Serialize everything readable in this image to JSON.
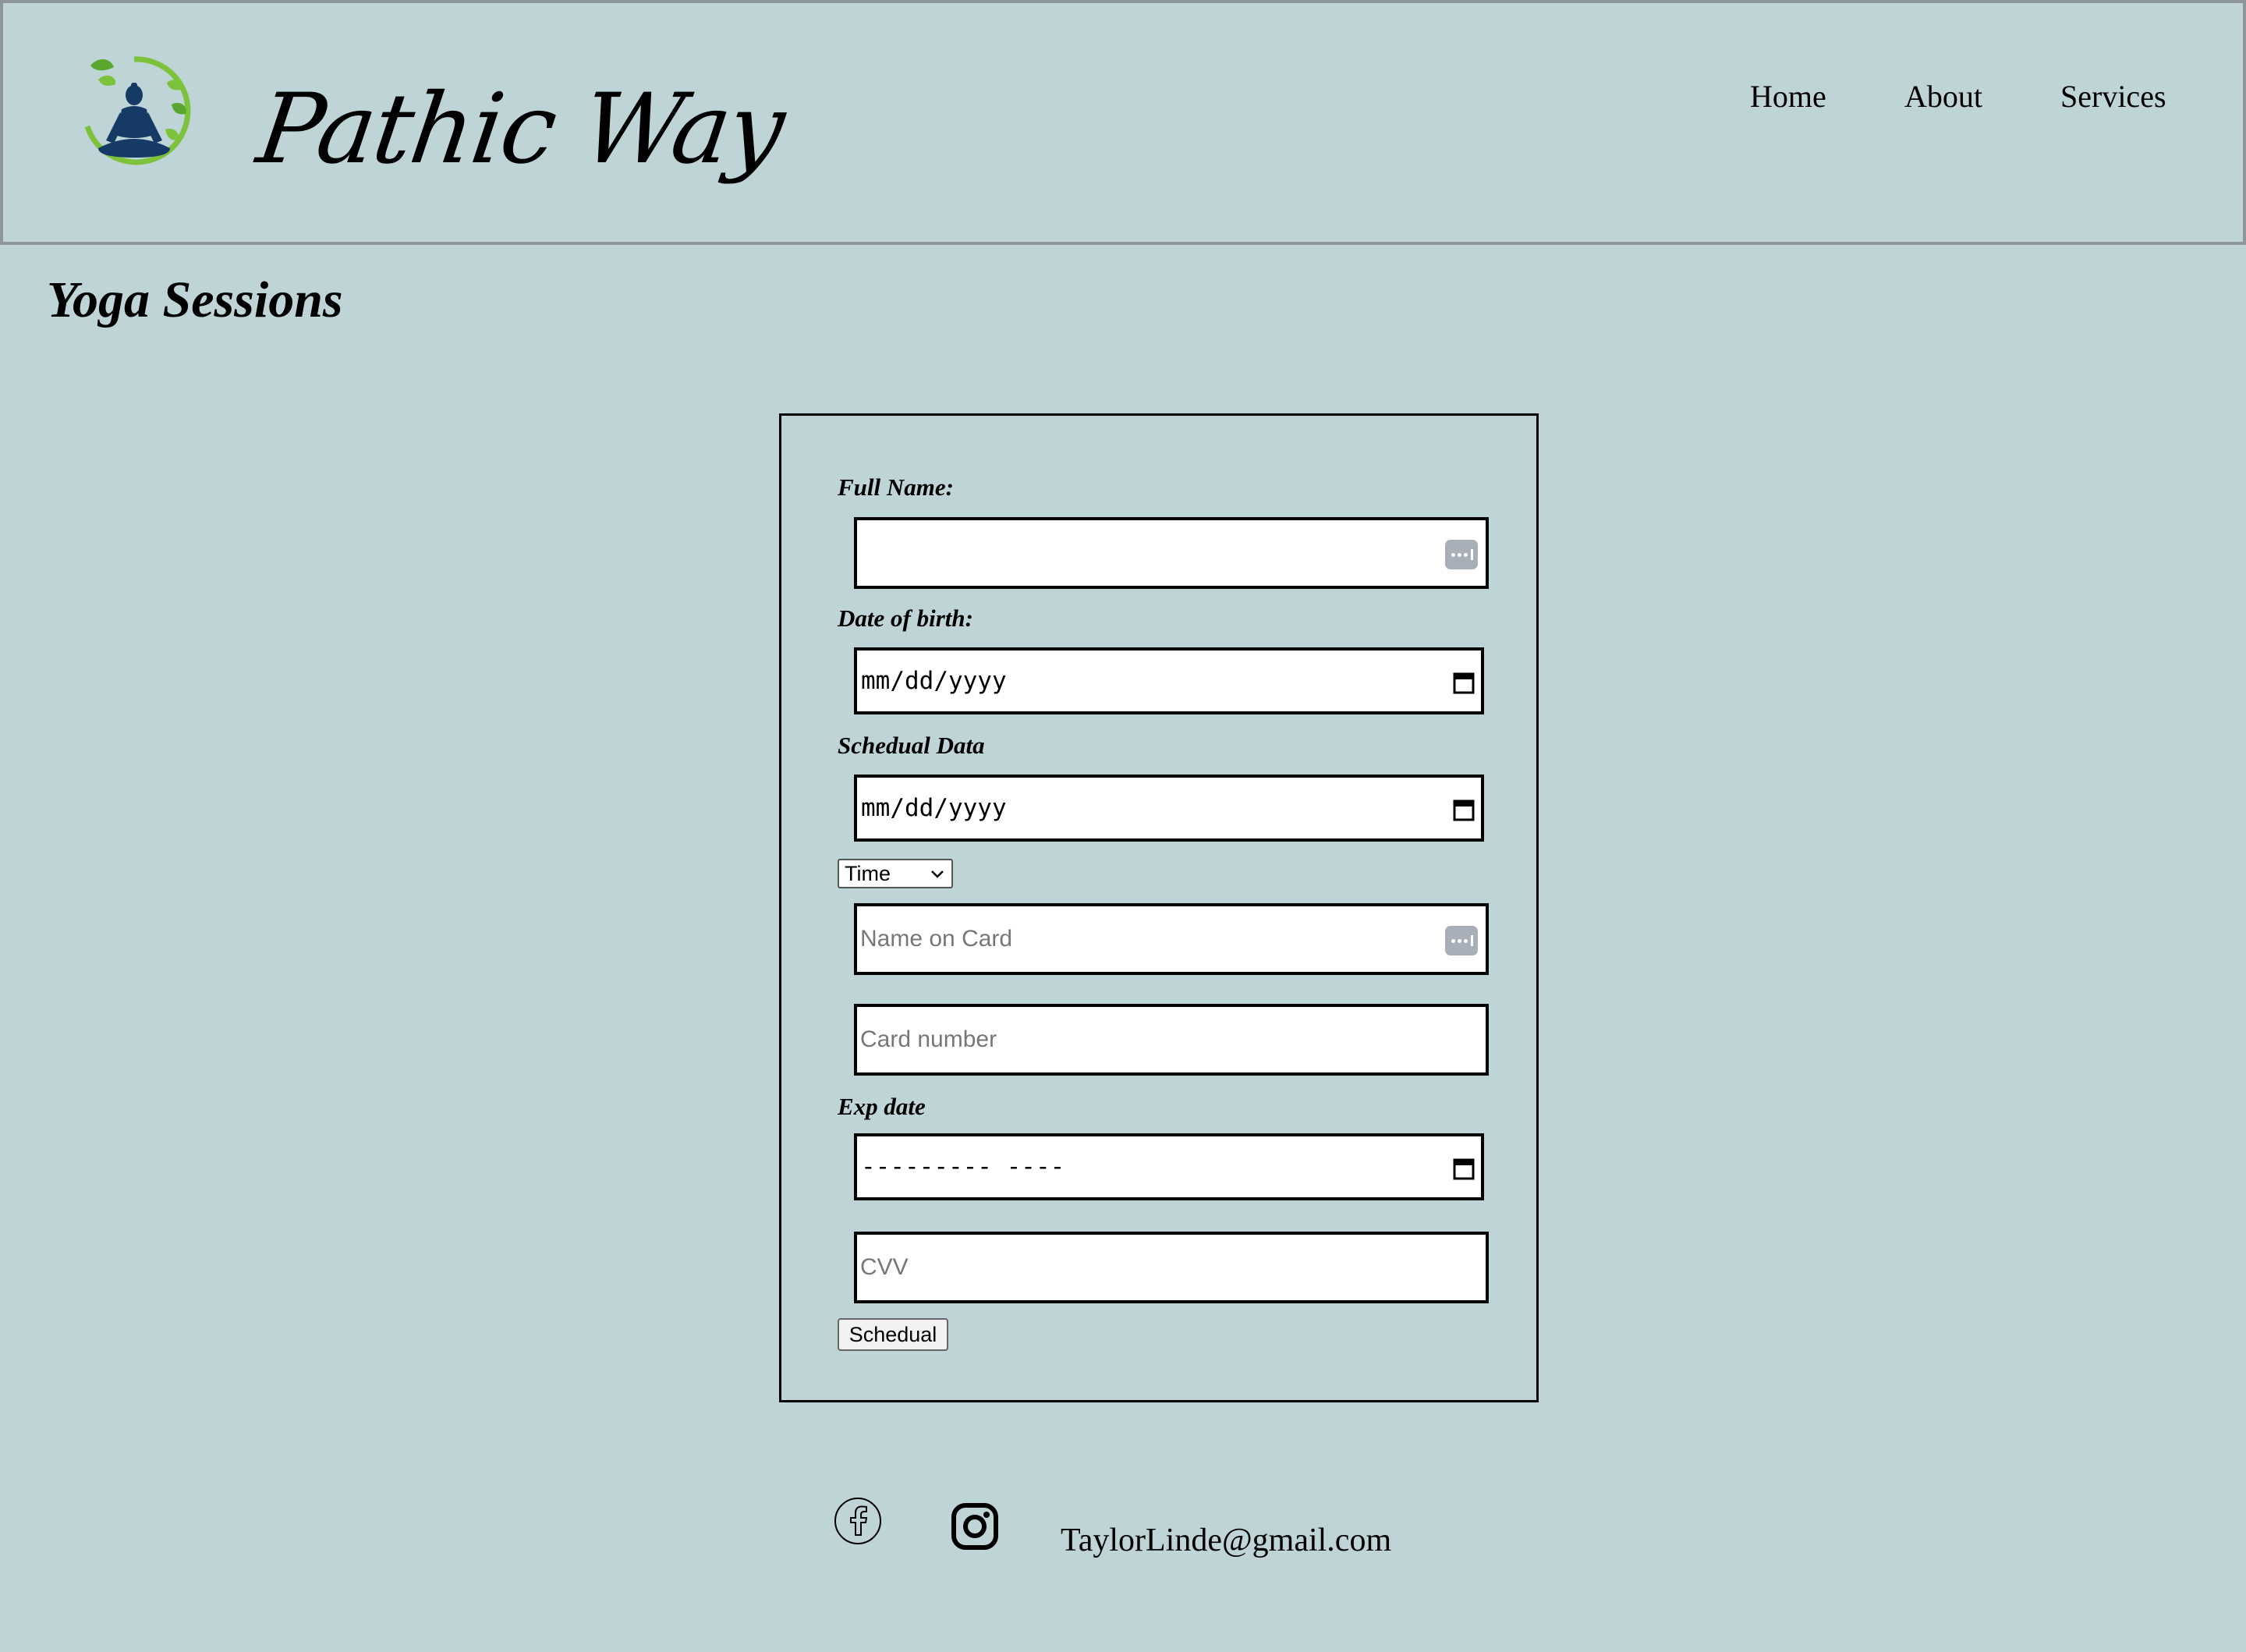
{
  "header": {
    "brand": "Pathic Way",
    "logo_icon": "meditation-lotus-icon",
    "nav": [
      "Home",
      "About",
      "Services"
    ]
  },
  "page": {
    "title": "Yoga Sessions"
  },
  "form": {
    "full_name_label": "Full Name:",
    "full_name_value": "",
    "dob_label": "Date of birth:",
    "dob_value": "mm/dd/yyyy",
    "schedule_label": "Schedual Data",
    "schedule_value": "mm/dd/yyyy",
    "time_select": "Time",
    "card_name_placeholder": "Name on Card",
    "card_number_placeholder": "Card number",
    "exp_label": "Exp date",
    "exp_value": "--------- ----",
    "cvv_placeholder": "CVV",
    "submit_label": "Schedual"
  },
  "footer": {
    "icons": [
      "facebook-icon",
      "instagram-icon"
    ],
    "email": "TaylorLinde@gmail.com"
  },
  "colors": {
    "background": "#bfd4d6",
    "header_border": "#8c969b",
    "logo_green": "#7cc23a",
    "logo_navy": "#163a66"
  }
}
